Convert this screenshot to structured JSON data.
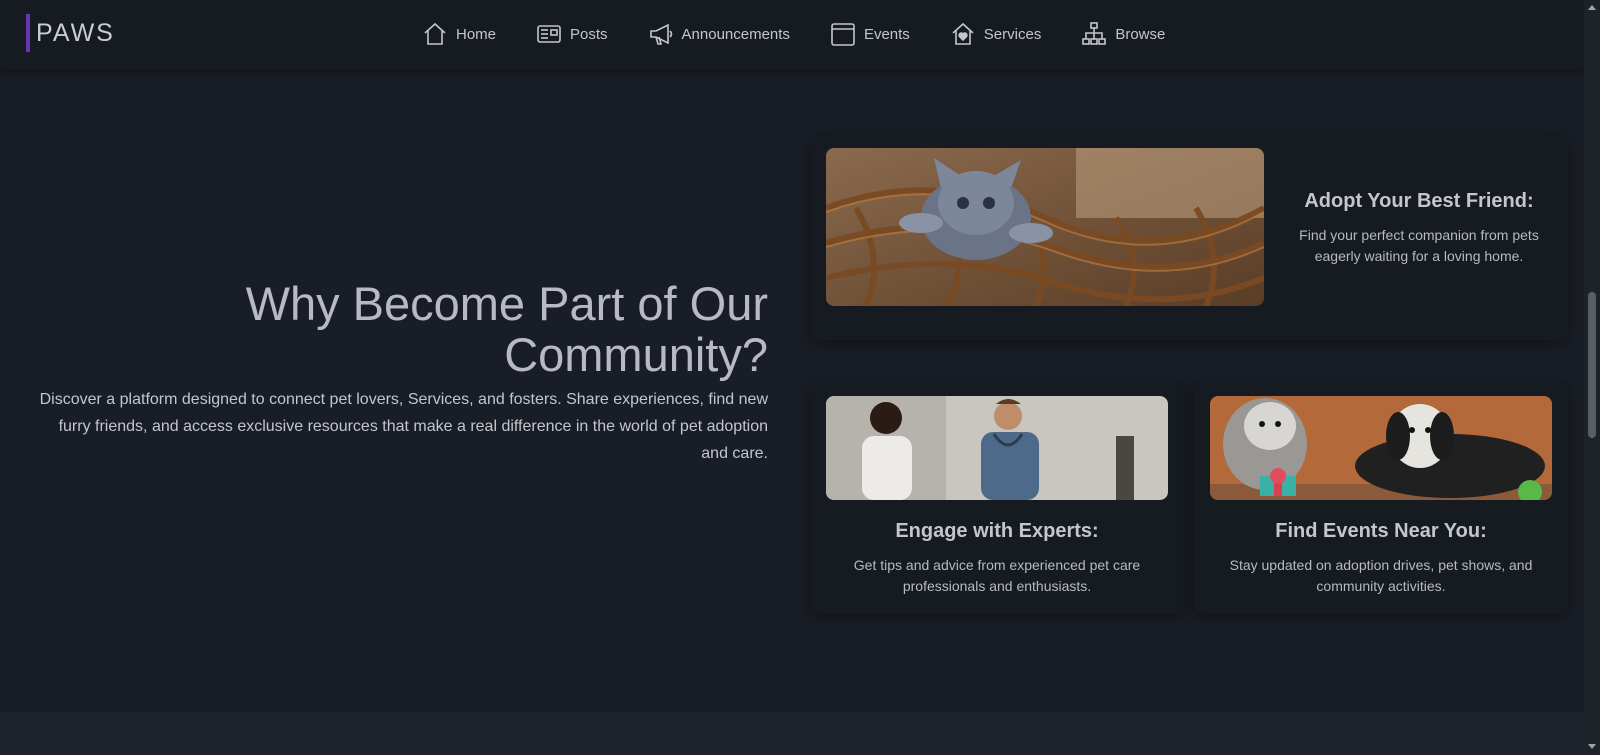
{
  "brand": {
    "logo": "PAWS",
    "accent": "#6a35b5"
  },
  "nav": {
    "items": [
      {
        "label": "Home",
        "icon": "home-icon"
      },
      {
        "label": "Posts",
        "icon": "newspaper-icon"
      },
      {
        "label": "Announcements",
        "icon": "megaphone-icon"
      },
      {
        "label": "Events",
        "icon": "calendar-icon"
      },
      {
        "label": "Services",
        "icon": "house-heart-icon"
      },
      {
        "label": "Browse",
        "icon": "sitemap-icon"
      }
    ]
  },
  "intro": {
    "title": "Why Become Part of Our Community?",
    "body": "Discover a platform designed to connect pet lovers, Services, and fosters. Share experiences, find new furry friends, and access exclusive resources that make a real difference in the world of pet adoption and care."
  },
  "features": [
    {
      "title": "Adopt Your Best Friend:",
      "desc": "Find your perfect companion from pets eagerly waiting for a loving home.",
      "image": "kitten-in-basket-photo"
    },
    {
      "title": "Engage with Experts:",
      "desc": "Get tips and advice from experienced pet care professionals and enthusiasts.",
      "image": "vet-staff-photo"
    },
    {
      "title": "Find Events Near You:",
      "desc": "Stay updated on adoption drives, pet shows, and community activities.",
      "image": "dogs-with-gifts-photo"
    }
  ]
}
